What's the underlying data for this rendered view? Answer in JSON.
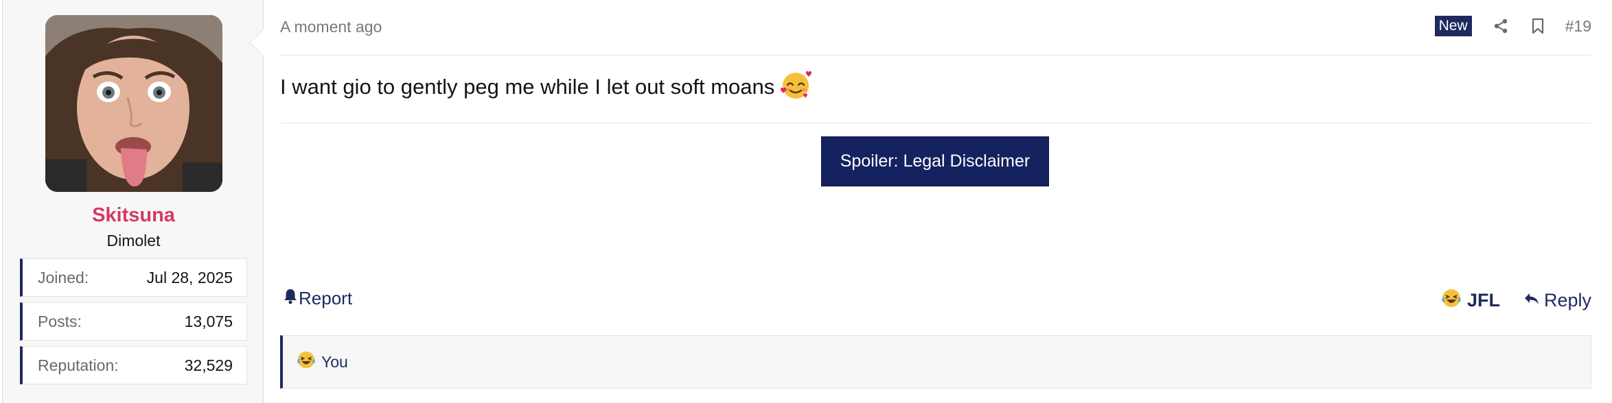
{
  "user": {
    "name": "Skitsuna",
    "title": "Dimolet",
    "stats": [
      {
        "label": "Joined:",
        "value": "Jul 28, 2025"
      },
      {
        "label": "Posts:",
        "value": "13,075"
      },
      {
        "label": "Reputation:",
        "value": "32,529"
      }
    ]
  },
  "post": {
    "date": "A moment ago",
    "badge": "New",
    "number": "#19",
    "body": "I want gio to gently peg me while I let out soft moans",
    "spoiler_label": "Spoiler: Legal Disclaimer"
  },
  "actions": {
    "report_label": "Report",
    "jfl_label": "JFL",
    "reply_label": "Reply"
  },
  "reactions": {
    "label": "You"
  },
  "colors": {
    "accent": "#1e2a5e",
    "spoiler": "#142260",
    "username": "#d63865"
  },
  "icons": [
    "share-icon",
    "bookmark-icon",
    "bell-icon",
    "reply-arrow-icon",
    "smiling-face-with-hearts-emoji",
    "laughing-crying-emoji"
  ]
}
